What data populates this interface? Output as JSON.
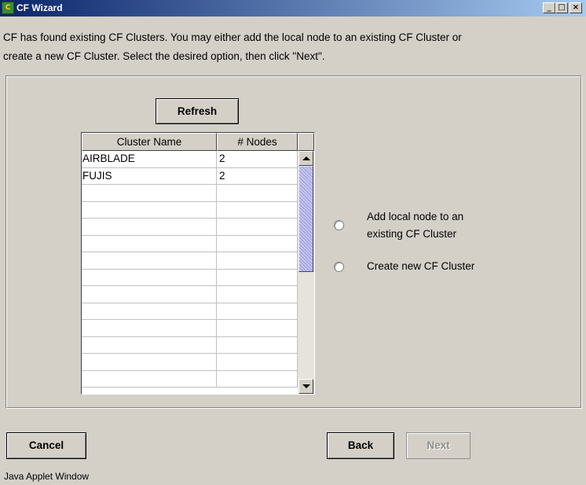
{
  "window": {
    "title": "CF Wizard",
    "app_icon": "cf-app-icon",
    "title_gradient": [
      "#0a246a",
      "#a6caf0"
    ],
    "controls": {
      "minimize": "minimize-icon",
      "maximize": "maximize-icon",
      "close": "close-icon"
    }
  },
  "instructions": {
    "line1": "CF has found existing CF Clusters. You may either add the local node to an existing CF Cluster or",
    "line2": "create a new CF Cluster. Select the desired option, then click \"Next\"."
  },
  "refresh_label": "Refresh",
  "table": {
    "columns": [
      "Cluster Name",
      "# Nodes"
    ],
    "rows": [
      [
        "AIRBLADE",
        "2"
      ],
      [
        "FUJIS",
        "2"
      ],
      [
        "",
        ""
      ],
      [
        "",
        ""
      ],
      [
        "",
        ""
      ],
      [
        "",
        ""
      ],
      [
        "",
        ""
      ],
      [
        "",
        ""
      ],
      [
        "",
        ""
      ],
      [
        "",
        ""
      ],
      [
        "",
        ""
      ],
      [
        "",
        ""
      ],
      [
        "",
        ""
      ],
      [
        "",
        ""
      ]
    ]
  },
  "options": {
    "add_local_line1": "Add local node to an",
    "add_local_line2": "existing CF Cluster",
    "create_new": "Create new CF Cluster",
    "selected": null
  },
  "buttons": {
    "cancel": "Cancel",
    "back": "Back",
    "next": "Next",
    "next_enabled": false
  },
  "status_bar": "Java Applet Window"
}
